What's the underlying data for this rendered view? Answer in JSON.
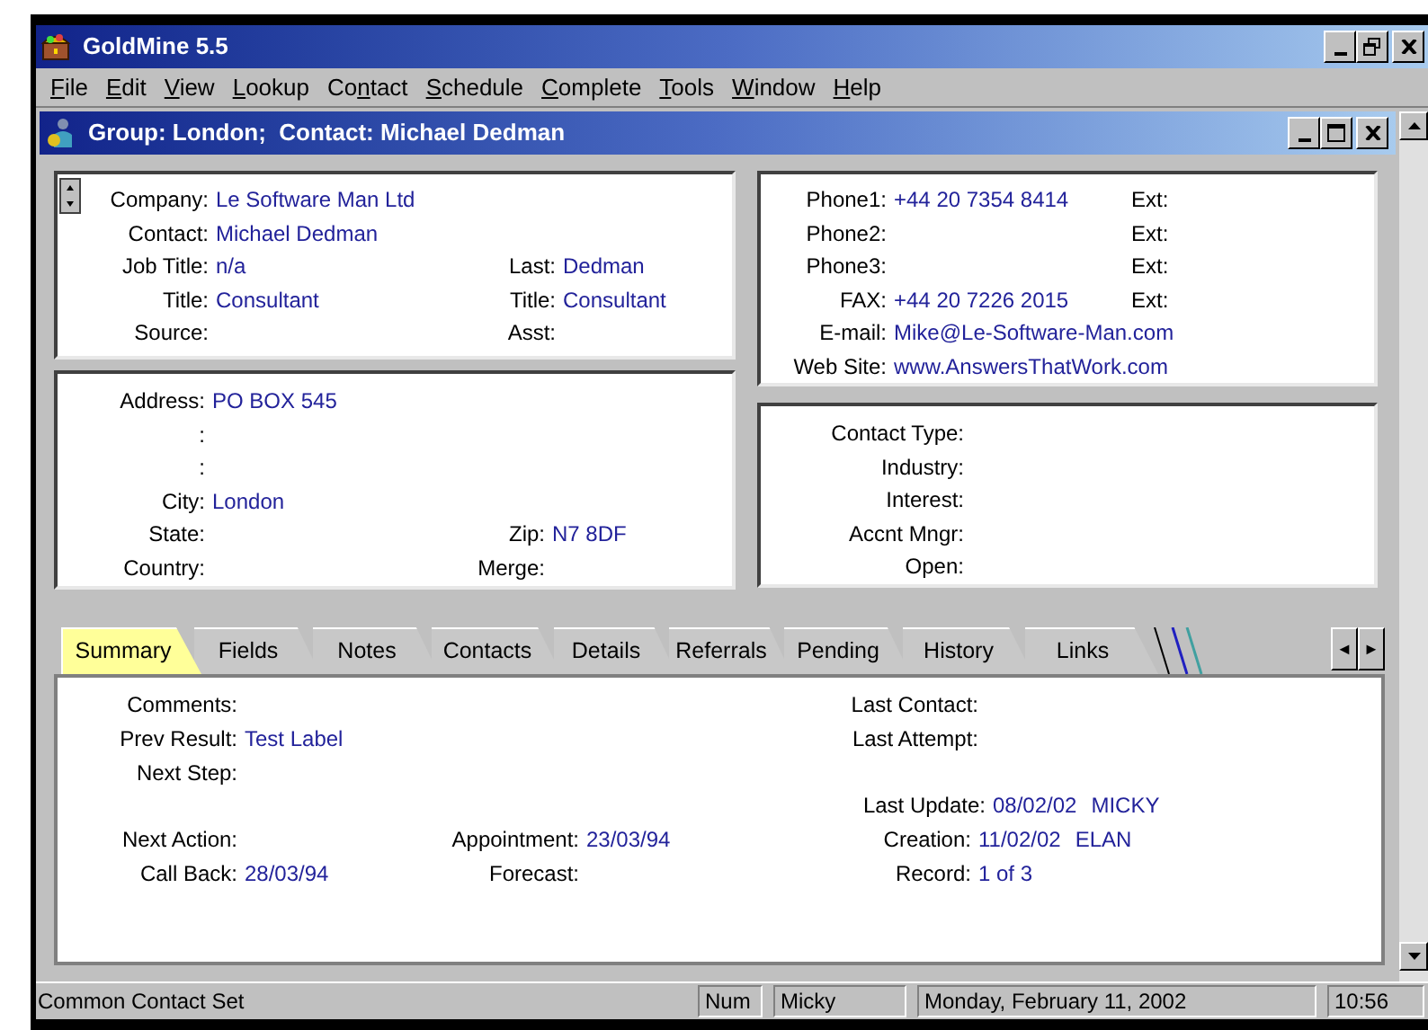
{
  "window": {
    "title": "GoldMine 5.5"
  },
  "menu": [
    {
      "key": "F",
      "post": "ile"
    },
    {
      "key": "E",
      "post": "dit"
    },
    {
      "key": "V",
      "post": "iew"
    },
    {
      "key": "L",
      "post": "ookup"
    },
    {
      "pre": "Co",
      "key": "n",
      "post": "tact"
    },
    {
      "key": "S",
      "post": "chedule"
    },
    {
      "key": "C",
      "post": "omplete"
    },
    {
      "key": "T",
      "post": "ools"
    },
    {
      "key": "W",
      "post": "indow"
    },
    {
      "key": "H",
      "post": "elp"
    }
  ],
  "child_window": {
    "title": "Group: London;  Contact: Michael Dedman"
  },
  "panels": [
    {
      "kind": "contact",
      "rows": [
        {
          "left": {
            "label": "Company:",
            "value": "Le Software Man Ltd"
          }
        },
        {
          "left": {
            "label": "Contact:",
            "value": "Michael Dedman"
          }
        },
        {
          "left": {
            "label": "Job Title:",
            "value": "n/a"
          },
          "right": {
            "label": "Last:",
            "value": "Dedman"
          }
        },
        {
          "left": {
            "label": "Title:",
            "value": "Consultant"
          },
          "right": {
            "label": "Title:",
            "value": "Consultant"
          }
        },
        {
          "left": {
            "label": "Source:"
          },
          "right": {
            "label": "Asst:"
          }
        }
      ]
    },
    {
      "kind": "address",
      "rows": [
        {
          "left": {
            "label": "Address:",
            "value": "PO BOX 545"
          }
        },
        {
          "left": {
            "label": ":"
          }
        },
        {
          "left": {
            "label": ":"
          }
        },
        {
          "left": {
            "label": "City:",
            "value": "London"
          }
        },
        {
          "left": {
            "label": "State:"
          },
          "right": {
            "label": "Zip:",
            "value": "N7 8DF"
          }
        },
        {
          "left": {
            "label": "Country:"
          },
          "right": {
            "label": "Merge:"
          }
        }
      ]
    },
    {
      "kind": "phone",
      "rows": [
        {
          "left": {
            "label": "Phone1:",
            "value": "+44 20 7354 8414"
          },
          "right": {
            "label": "Ext:"
          }
        },
        {
          "left": {
            "label": "Phone2:"
          },
          "right": {
            "label": "Ext:"
          }
        },
        {
          "left": {
            "label": "Phone3:"
          },
          "right": {
            "label": "Ext:"
          }
        },
        {
          "left": {
            "label": "FAX:",
            "value": "+44 20 7226 2015"
          },
          "right": {
            "label": "Ext:"
          }
        },
        {
          "left": {
            "label": "E-mail:",
            "value": "Mike@Le-Software-Man.com"
          }
        },
        {
          "left": {
            "label": "Web Site:",
            "value": "www.AnswersThatWork.com"
          }
        }
      ]
    },
    {
      "kind": "profile",
      "rows": [
        {
          "left": {
            "label": "Contact Type:"
          }
        },
        {
          "left": {
            "label": "Industry:"
          }
        },
        {
          "left": {
            "label": "Interest:"
          }
        },
        {
          "left": {
            "label": "Accnt Mngr:"
          }
        },
        {
          "left": {
            "label": "Open:"
          }
        }
      ]
    }
  ],
  "tabs": [
    {
      "label": "Summary",
      "selected": true
    },
    {
      "label": "Fields",
      "selected": false
    },
    {
      "label": "Notes",
      "selected": false
    },
    {
      "label": "Contacts",
      "selected": false
    },
    {
      "label": "Details",
      "selected": false
    },
    {
      "label": "Referrals",
      "selected": false
    },
    {
      "label": "Pending",
      "selected": false
    },
    {
      "label": "History",
      "selected": false
    },
    {
      "label": "Links",
      "selected": false
    }
  ],
  "tab_scroll": {
    "left": "◄",
    "right": "►"
  },
  "summary": {
    "rows": [
      {
        "left": {
          "label": "Comments:"
        },
        "right": {
          "label": "Last Contact:"
        }
      },
      {
        "left": {
          "label": "Prev Result:",
          "value": "Test Label"
        },
        "right": {
          "label": "Last Attempt:"
        }
      },
      {
        "left": {
          "label": "Next Step:"
        }
      },
      {
        "right": {
          "label": "Last Update:",
          "value": "08/02/02",
          "value_2": "MICKY"
        }
      },
      {
        "left": {
          "label": "Next Action:"
        },
        "middle": {
          "label": "Appointment:",
          "value": "23/03/94"
        },
        "right": {
          "label": "Creation:",
          "value": "11/02/02",
          "value_2": "ELAN"
        }
      },
      {
        "left": {
          "label": "Call Back:",
          "value": "28/03/94"
        },
        "middle": {
          "label": "Forecast:"
        },
        "right": {
          "label": "Record:",
          "value": "1 of 3"
        }
      }
    ]
  },
  "status_bar": [
    {
      "text": "Common Contact Set",
      "kind": "plain"
    },
    {
      "text": "Num",
      "kind": "sunken"
    },
    {
      "text": "Micky",
      "kind": "sunken"
    },
    {
      "text": "Monday, February 11, 2002",
      "kind": "sunken"
    },
    {
      "text": "10:56",
      "kind": "sunken"
    }
  ]
}
